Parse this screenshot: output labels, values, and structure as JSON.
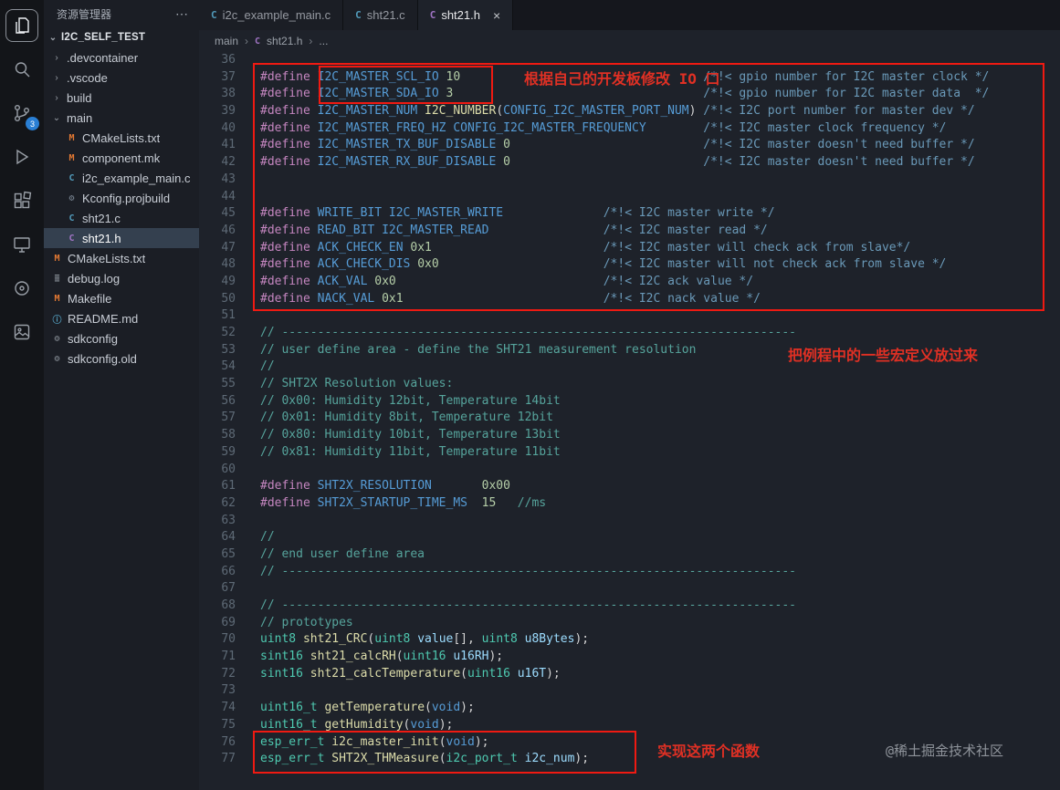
{
  "activity_bar": {
    "scm_badge": "3",
    "icons": [
      "explorer",
      "search",
      "source-control",
      "run-debug",
      "extensions",
      "remote-explorer",
      "ports",
      "image-tool"
    ]
  },
  "sidebar": {
    "title": "资源管理器",
    "more_label": "⋯",
    "section": "I2C_SELF_TEST",
    "section_chevron": "⌄",
    "files": [
      {
        "label": ".devcontainer",
        "kind": "folder"
      },
      {
        "label": ".vscode",
        "kind": "folder"
      },
      {
        "label": "build",
        "kind": "folder"
      },
      {
        "label": "main",
        "kind": "folder-open"
      },
      {
        "label": "CMakeLists.txt",
        "kind": "file",
        "glyph": "M",
        "color": "#e37933",
        "level": 1
      },
      {
        "label": "component.mk",
        "kind": "file",
        "glyph": "M",
        "color": "#e37933",
        "level": 1
      },
      {
        "label": "i2c_example_main.c",
        "kind": "file",
        "glyph": "C",
        "color": "#519aba",
        "level": 1
      },
      {
        "label": "Kconfig.projbuild",
        "kind": "file",
        "glyph": "⚙",
        "color": "#7f8b99",
        "level": 1
      },
      {
        "label": "sht21.c",
        "kind": "file",
        "glyph": "C",
        "color": "#519aba",
        "level": 1
      },
      {
        "label": "sht21.h",
        "kind": "file",
        "glyph": "C",
        "color": "#a074c4",
        "level": 1,
        "selected": true
      },
      {
        "label": "CMakeLists.txt",
        "kind": "file",
        "glyph": "M",
        "color": "#e37933",
        "level": 0
      },
      {
        "label": "debug.log",
        "kind": "file",
        "glyph": "≣",
        "color": "#8a9199",
        "level": 0
      },
      {
        "label": "Makefile",
        "kind": "file",
        "glyph": "M",
        "color": "#e37933",
        "level": 0
      },
      {
        "label": "README.md",
        "kind": "file",
        "glyph": "ⓘ",
        "color": "#519aba",
        "level": 0
      },
      {
        "label": "sdkconfig",
        "kind": "file",
        "glyph": "⚙",
        "color": "#8a9199",
        "level": 0
      },
      {
        "label": "sdkconfig.old",
        "kind": "file",
        "glyph": "⚙",
        "color": "#8a9199",
        "level": 0
      }
    ]
  },
  "editor": {
    "tabs": [
      {
        "label": "i2c_example_main.c",
        "icon": "C",
        "icon_color": "#519aba",
        "active": false
      },
      {
        "label": "sht21.c",
        "icon": "C",
        "icon_color": "#519aba",
        "active": false
      },
      {
        "label": "sht21.h",
        "icon": "C",
        "icon_color": "#a074c4",
        "active": true,
        "close": "×"
      }
    ],
    "breadcrumb": [
      {
        "label": "main"
      },
      {
        "label": "sht21.h",
        "icon": "C",
        "icon_color": "#a074c4"
      },
      {
        "label": "..."
      }
    ],
    "breadcrumb_sep": "›",
    "lines": [
      {
        "n": 36,
        "t": []
      },
      {
        "n": 37,
        "t": [
          [
            "def",
            "#define "
          ],
          [
            "macro",
            "I2C_MASTER_SCL_IO"
          ],
          [
            "pln",
            " "
          ],
          [
            "num",
            "10"
          ],
          [
            "pln",
            "                                  "
          ],
          [
            "doc",
            "/*!< gpio number for I2C master clock */"
          ]
        ]
      },
      {
        "n": 38,
        "t": [
          [
            "def",
            "#define "
          ],
          [
            "macro",
            "I2C_MASTER_SDA_IO"
          ],
          [
            "pln",
            " "
          ],
          [
            "num",
            "3"
          ],
          [
            "pln",
            "                                   "
          ],
          [
            "doc",
            "/*!< gpio number for I2C master data  */"
          ]
        ]
      },
      {
        "n": 39,
        "t": [
          [
            "def",
            "#define "
          ],
          [
            "macro",
            "I2C_MASTER_NUM"
          ],
          [
            "pln",
            " "
          ],
          [
            "fn",
            "I2C_NUMBER"
          ],
          [
            "pun",
            "("
          ],
          [
            "macro",
            "CONFIG_I2C_MASTER_PORT_NUM"
          ],
          [
            "pun",
            ")"
          ],
          [
            "pln",
            " "
          ],
          [
            "doc",
            "/*!< I2C port number for master dev */"
          ]
        ]
      },
      {
        "n": 40,
        "t": [
          [
            "def",
            "#define "
          ],
          [
            "macro",
            "I2C_MASTER_FREQ_HZ"
          ],
          [
            "pln",
            " "
          ],
          [
            "macro",
            "CONFIG_I2C_MASTER_FREQUENCY"
          ],
          [
            "pln",
            "        "
          ],
          [
            "doc",
            "/*!< I2C master clock frequency */"
          ]
        ]
      },
      {
        "n": 41,
        "t": [
          [
            "def",
            "#define "
          ],
          [
            "macro",
            "I2C_MASTER_TX_BUF_DISABLE"
          ],
          [
            "pln",
            " "
          ],
          [
            "num",
            "0"
          ],
          [
            "pln",
            "                           "
          ],
          [
            "doc",
            "/*!< I2C master doesn't need buffer */"
          ]
        ]
      },
      {
        "n": 42,
        "t": [
          [
            "def",
            "#define "
          ],
          [
            "macro",
            "I2C_MASTER_RX_BUF_DISABLE"
          ],
          [
            "pln",
            " "
          ],
          [
            "num",
            "0"
          ],
          [
            "pln",
            "                           "
          ],
          [
            "doc",
            "/*!< I2C master doesn't need buffer */"
          ]
        ]
      },
      {
        "n": 43,
        "t": []
      },
      {
        "n": 44,
        "t": []
      },
      {
        "n": 45,
        "t": [
          [
            "def",
            "#define "
          ],
          [
            "macro",
            "WRITE_BIT"
          ],
          [
            "pln",
            " "
          ],
          [
            "macro",
            "I2C_MASTER_WRITE"
          ],
          [
            "pln",
            "              "
          ],
          [
            "doc",
            "/*!< I2C master write */"
          ]
        ]
      },
      {
        "n": 46,
        "t": [
          [
            "def",
            "#define "
          ],
          [
            "macro",
            "READ_BIT"
          ],
          [
            "pln",
            " "
          ],
          [
            "macro",
            "I2C_MASTER_READ"
          ],
          [
            "pln",
            "                "
          ],
          [
            "doc",
            "/*!< I2C master read */"
          ]
        ]
      },
      {
        "n": 47,
        "t": [
          [
            "def",
            "#define "
          ],
          [
            "macro",
            "ACK_CHECK_EN"
          ],
          [
            "pln",
            " "
          ],
          [
            "num",
            "0x1"
          ],
          [
            "pln",
            "                        "
          ],
          [
            "doc",
            "/*!< I2C master will check ack from slave*/"
          ]
        ]
      },
      {
        "n": 48,
        "t": [
          [
            "def",
            "#define "
          ],
          [
            "macro",
            "ACK_CHECK_DIS"
          ],
          [
            "pln",
            " "
          ],
          [
            "num",
            "0x0"
          ],
          [
            "pln",
            "                       "
          ],
          [
            "doc",
            "/*!< I2C master will not check ack from slave */"
          ]
        ]
      },
      {
        "n": 49,
        "t": [
          [
            "def",
            "#define "
          ],
          [
            "macro",
            "ACK_VAL"
          ],
          [
            "pln",
            " "
          ],
          [
            "num",
            "0x0"
          ],
          [
            "pln",
            "                             "
          ],
          [
            "doc",
            "/*!< I2C ack value */"
          ]
        ]
      },
      {
        "n": 50,
        "t": [
          [
            "def",
            "#define "
          ],
          [
            "macro",
            "NACK_VAL"
          ],
          [
            "pln",
            " "
          ],
          [
            "num",
            "0x1"
          ],
          [
            "pln",
            "                            "
          ],
          [
            "doc",
            "/*!< I2C nack value */"
          ]
        ]
      },
      {
        "n": 51,
        "t": []
      },
      {
        "n": 52,
        "t": [
          [
            "cmt",
            "// ------------------------------------------------------------------------"
          ]
        ]
      },
      {
        "n": 53,
        "t": [
          [
            "cmt",
            "// user define area - define the SHT21 measurement resolution"
          ]
        ]
      },
      {
        "n": 54,
        "t": [
          [
            "cmt",
            "//"
          ]
        ]
      },
      {
        "n": 55,
        "t": [
          [
            "cmt",
            "// SHT2X Resolution values:"
          ]
        ]
      },
      {
        "n": 56,
        "t": [
          [
            "cmt",
            "// 0x00: Humidity 12bit, Temperature 14bit"
          ]
        ]
      },
      {
        "n": 57,
        "t": [
          [
            "cmt",
            "// 0x01: Humidity 8bit, Temperature 12bit"
          ]
        ]
      },
      {
        "n": 58,
        "t": [
          [
            "cmt",
            "// 0x80: Humidity 10bit, Temperature 13bit"
          ]
        ]
      },
      {
        "n": 59,
        "t": [
          [
            "cmt",
            "// 0x81: Humidity 11bit, Temperature 11bit"
          ]
        ]
      },
      {
        "n": 60,
        "t": []
      },
      {
        "n": 61,
        "t": [
          [
            "def",
            "#define "
          ],
          [
            "macro",
            "SHT2X_RESOLUTION"
          ],
          [
            "pln",
            "       "
          ],
          [
            "num",
            "0x00"
          ]
        ]
      },
      {
        "n": 62,
        "t": [
          [
            "def",
            "#define "
          ],
          [
            "macro",
            "SHT2X_STARTUP_TIME_MS"
          ],
          [
            "pln",
            "  "
          ],
          [
            "num",
            "15"
          ],
          [
            "pln",
            "   "
          ],
          [
            "cmt",
            "//ms"
          ]
        ]
      },
      {
        "n": 63,
        "t": []
      },
      {
        "n": 64,
        "t": [
          [
            "cmt",
            "//"
          ]
        ]
      },
      {
        "n": 65,
        "t": [
          [
            "cmt",
            "// end user define area"
          ]
        ]
      },
      {
        "n": 66,
        "t": [
          [
            "cmt",
            "// ------------------------------------------------------------------------"
          ]
        ]
      },
      {
        "n": 67,
        "t": []
      },
      {
        "n": 68,
        "t": [
          [
            "cmt",
            "// ------------------------------------------------------------------------"
          ]
        ]
      },
      {
        "n": 69,
        "t": [
          [
            "cmt",
            "// prototypes"
          ]
        ]
      },
      {
        "n": 70,
        "t": [
          [
            "type",
            "uint8"
          ],
          [
            "pln",
            " "
          ],
          [
            "fn",
            "sht21_CRC"
          ],
          [
            "pun",
            "("
          ],
          [
            "type",
            "uint8"
          ],
          [
            "pln",
            " "
          ],
          [
            "param",
            "value"
          ],
          [
            "pun",
            "[], "
          ],
          [
            "type",
            "uint8"
          ],
          [
            "pln",
            " "
          ],
          [
            "param",
            "u8Bytes"
          ],
          [
            "pun",
            ");"
          ]
        ]
      },
      {
        "n": 71,
        "t": [
          [
            "type",
            "sint16"
          ],
          [
            "pln",
            " "
          ],
          [
            "fn",
            "sht21_calcRH"
          ],
          [
            "pun",
            "("
          ],
          [
            "type",
            "uint16"
          ],
          [
            "pln",
            " "
          ],
          [
            "param",
            "u16RH"
          ],
          [
            "pun",
            ");"
          ]
        ]
      },
      {
        "n": 72,
        "t": [
          [
            "type",
            "sint16"
          ],
          [
            "pln",
            " "
          ],
          [
            "fn",
            "sht21_calcTemperature"
          ],
          [
            "pun",
            "("
          ],
          [
            "type",
            "uint16"
          ],
          [
            "pln",
            " "
          ],
          [
            "param",
            "u16T"
          ],
          [
            "pun",
            ");"
          ]
        ]
      },
      {
        "n": 73,
        "t": []
      },
      {
        "n": 74,
        "t": [
          [
            "type",
            "uint16_t"
          ],
          [
            "pln",
            " "
          ],
          [
            "fn",
            "getTemperature"
          ],
          [
            "pun",
            "("
          ],
          [
            "kw",
            "void"
          ],
          [
            "pun",
            ");"
          ]
        ]
      },
      {
        "n": 75,
        "t": [
          [
            "type",
            "uint16_t"
          ],
          [
            "pln",
            " "
          ],
          [
            "fn",
            "getHumidity"
          ],
          [
            "pun",
            "("
          ],
          [
            "kw",
            "void"
          ],
          [
            "pun",
            ");"
          ]
        ]
      },
      {
        "n": 76,
        "t": [
          [
            "type",
            "esp_err_t"
          ],
          [
            "pln",
            " "
          ],
          [
            "fn",
            "i2c_master_init"
          ],
          [
            "pun",
            "("
          ],
          [
            "kw",
            "void"
          ],
          [
            "pun",
            ");"
          ]
        ]
      },
      {
        "n": 77,
        "t": [
          [
            "type",
            "esp_err_t"
          ],
          [
            "pln",
            " "
          ],
          [
            "fn",
            "SHT2X_THMeasure"
          ],
          [
            "pun",
            "("
          ],
          [
            "type",
            "i2c_port_t"
          ],
          [
            "pln",
            " "
          ],
          [
            "param",
            "i2c_num"
          ],
          [
            "pun",
            ");"
          ]
        ]
      }
    ]
  },
  "annotations": {
    "io_note": "根据自己的开发板修改 IO 口",
    "macro_note": "把例程中的一些宏定义放过来",
    "impl_note": "实现这两个函数"
  },
  "watermark": "@稀土掘金技术社区"
}
